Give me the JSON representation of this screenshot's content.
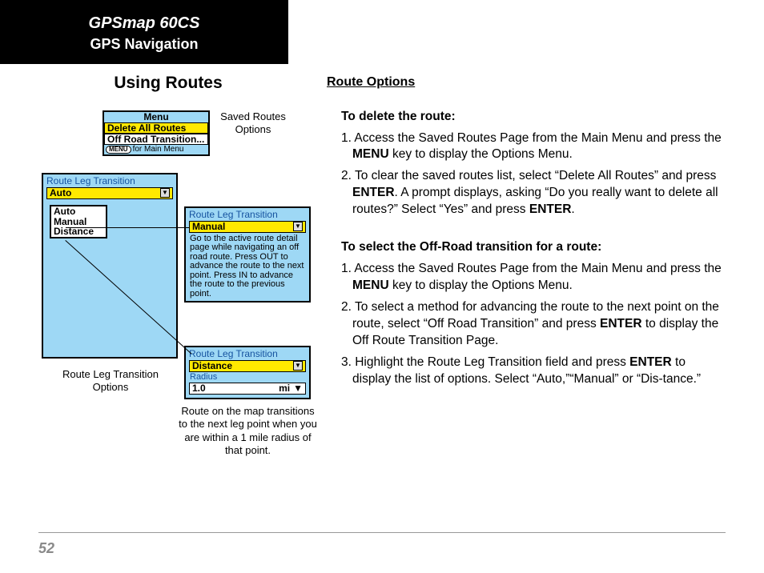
{
  "header": {
    "line1": "GPSmap 60CS",
    "line2": "GPS Navigation"
  },
  "section_title": "Using Routes",
  "page_number": "52",
  "captions": {
    "saved": "Saved Routes Options",
    "rlt": "Route Leg Transition Options",
    "dist": "Route on the map transitions to the next leg point when you are within a 1 mile radius of that point."
  },
  "menu_popup": {
    "title": "Menu",
    "items": [
      "Delete All Routes",
      "Off Road Transition..."
    ],
    "footer_button": "MENU",
    "footer_text": "for Main Menu"
  },
  "auto_screen": {
    "title": "Route Leg Transition",
    "selected": "Auto",
    "options": [
      "Auto",
      "Manual",
      "Distance"
    ]
  },
  "manual_screen": {
    "title": "Route Leg Transition",
    "selected": "Manual",
    "body": "Go to the active route detail page while navigating an off road route. Press OUT to advance the route to the next point. Press IN to advance the route to the previous point."
  },
  "distance_screen": {
    "title": "Route Leg Transition",
    "selected": "Distance",
    "radius_label": "Radius",
    "radius_value": "1.0",
    "radius_unit": "mi"
  },
  "right": {
    "heading": "Route Options",
    "delete": {
      "title": "To delete the route:",
      "s1a": "1. Access the Saved Routes Page from the Main Menu and press the ",
      "s1b": "MENU",
      "s1c": " key to display the Options Menu.",
      "s2a": "2. To clear the saved routes list, select “Delete All Routes” and press ",
      "s2b": "ENTER",
      "s2c": ". A prompt displays, asking “Do you really want to delete all routes?”  Select “Yes” and press ",
      "s2d": "ENTER",
      "s2e": "."
    },
    "offroad": {
      "title": "To select the Off-Road transition for a route:",
      "s1a": "1. Access the Saved Routes Page from the Main Menu and press the ",
      "s1b": "MENU",
      "s1c": " key to display the Options Menu.",
      "s2a": "2. To select a method for advancing the route to the next point on the route, select “Off Road Transition” and press ",
      "s2b": "ENTER",
      "s2c": " to display the Off Route Transition Page.",
      "s3a": "3. Highlight the Route Leg Transition field and press ",
      "s3b": "ENTER",
      "s3c": " to display the list of options. Select “Auto,”“Manual” or “Dis‑tance.”"
    }
  }
}
